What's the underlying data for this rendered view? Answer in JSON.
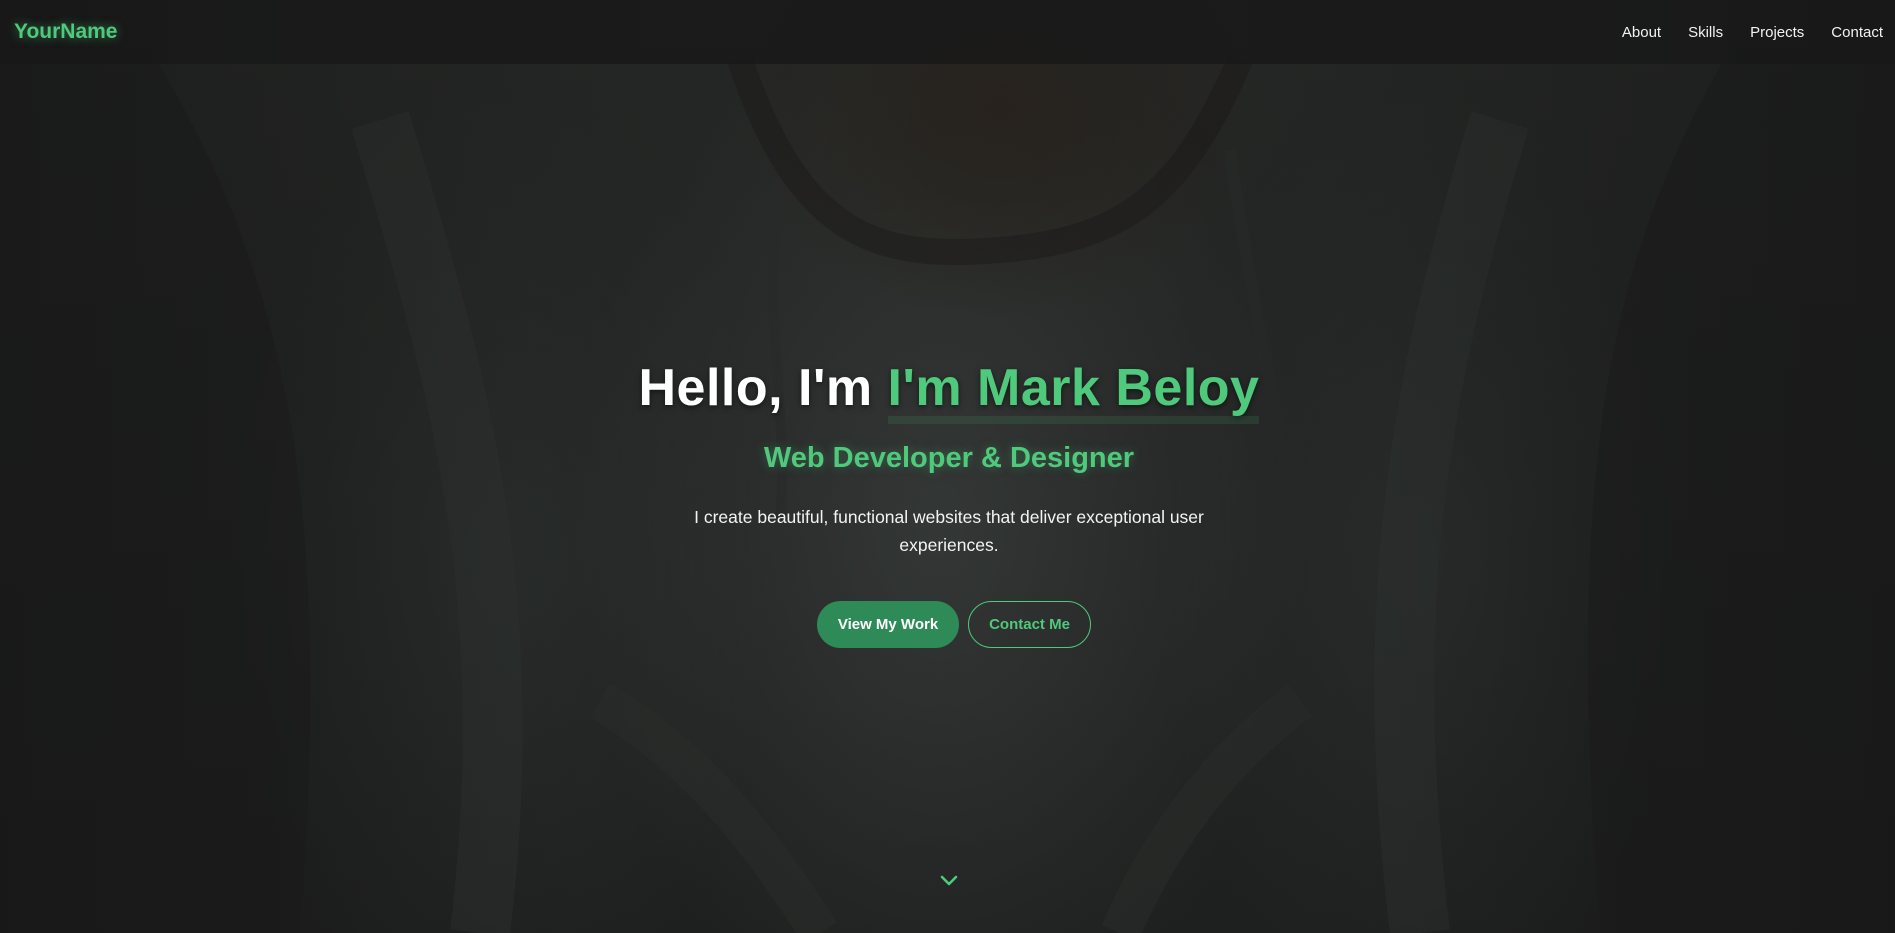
{
  "navbar": {
    "logo": "YourName",
    "links": [
      "About",
      "Skills",
      "Projects",
      "Contact"
    ]
  },
  "hero": {
    "greeting": "Hello, I'm ",
    "name": "I'm Mark Beloy",
    "subtitle": "Web Developer & Designer",
    "description": "I create beautiful, functional websites that deliver exceptional user experiences.",
    "primary_button": "View My Work",
    "secondary_button": "Contact Me",
    "scroll_icon": "chevron-down-icon"
  },
  "colors": {
    "accent": "#4fc97b",
    "button_primary": "#2e8b57",
    "navbar_bg": "#181818",
    "text": "#ffffff"
  }
}
